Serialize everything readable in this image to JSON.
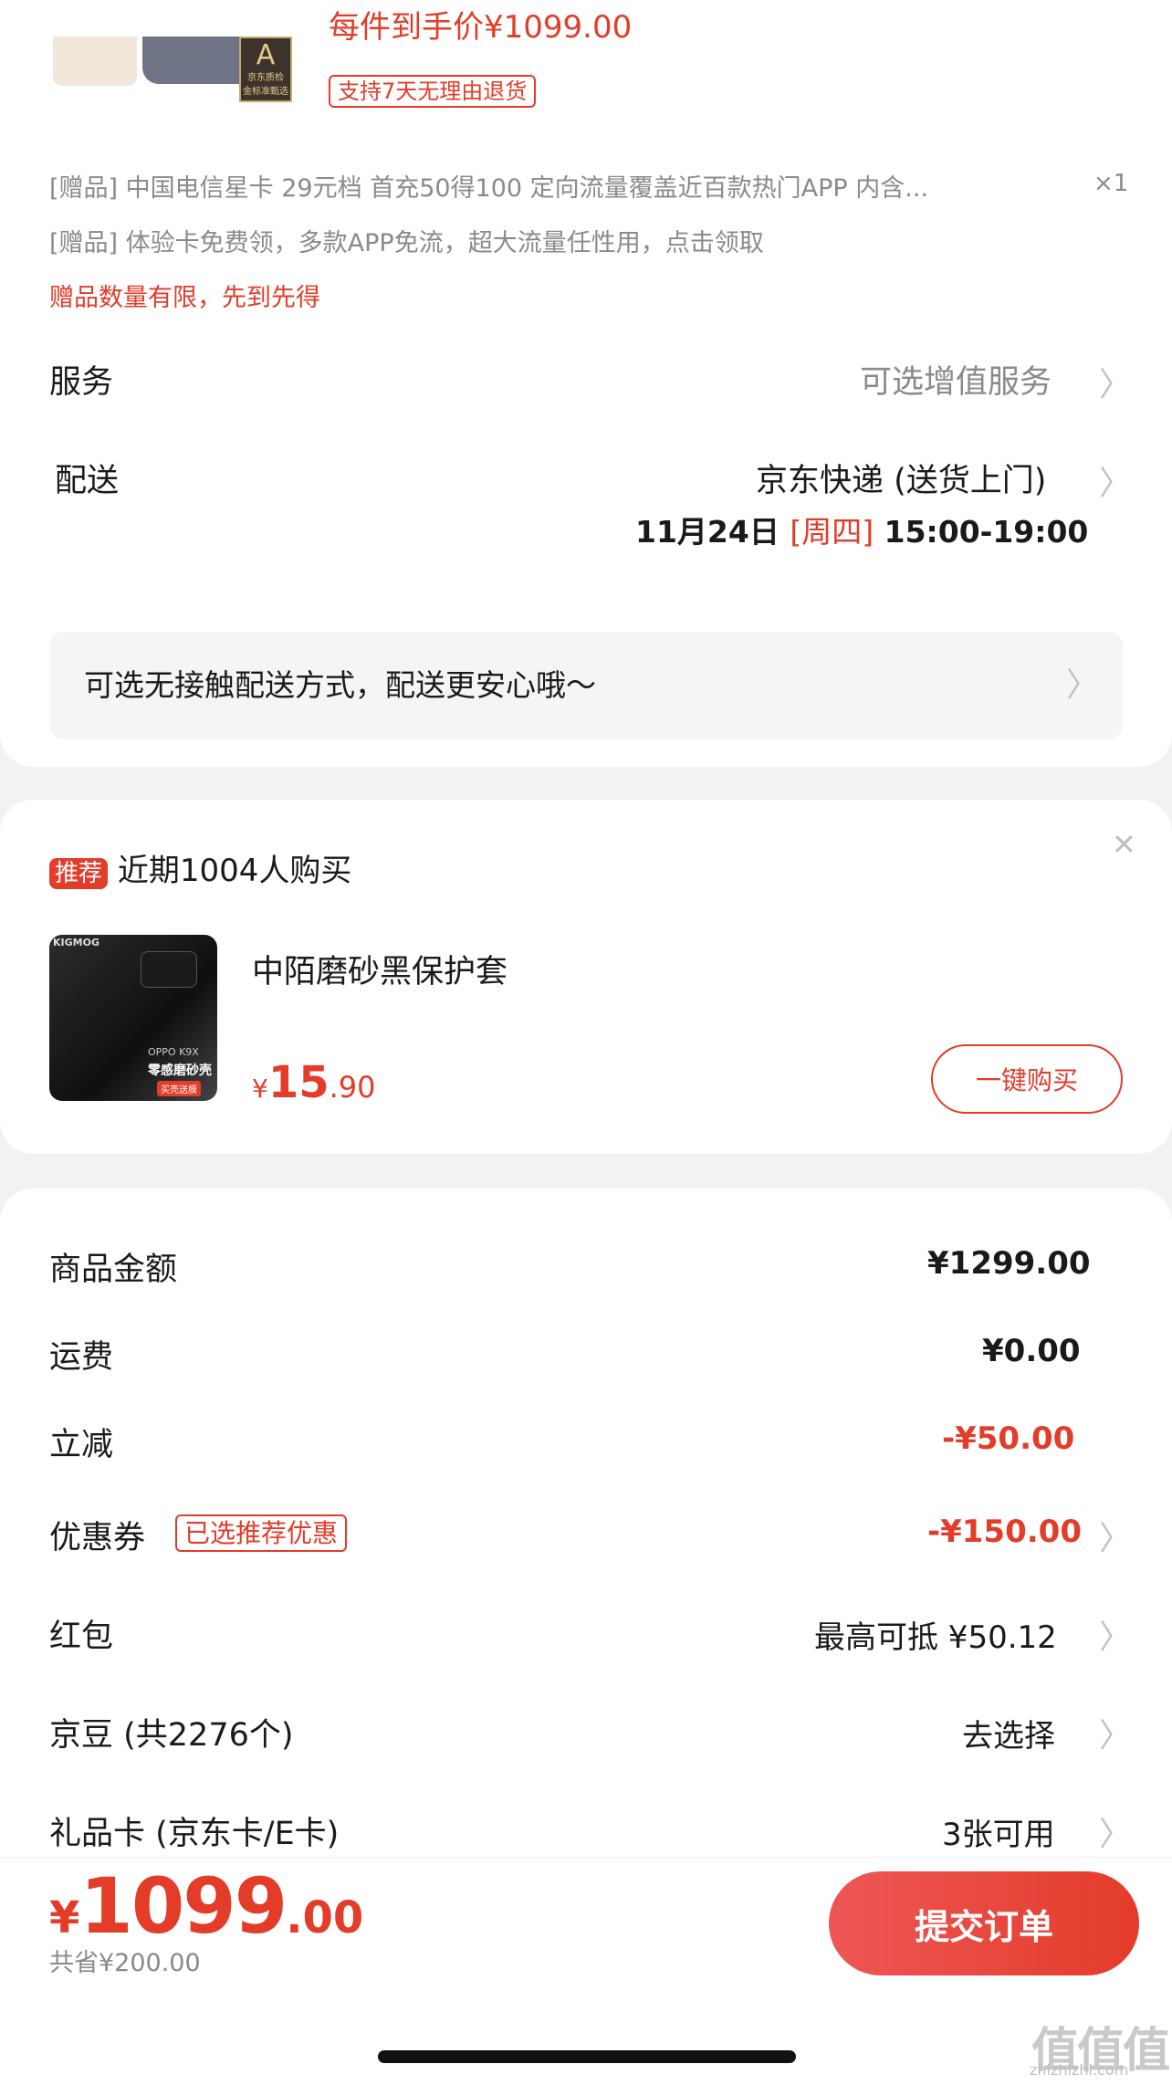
{
  "product": {
    "price_line": "每件到手价¥1099.00",
    "quality_badge_letter": "A",
    "quality_badge_text": "京东质检",
    "quality_badge_sub": "金标准甄选",
    "return_badge": "支持7天无理由退货"
  },
  "gifts": [
    {
      "label": "[赠品]",
      "text": "中国电信星卡 29元档 首充50得100 定向流量覆盖近百款热门APP 内含...",
      "qty": "×1"
    },
    {
      "label": "[赠品]",
      "text": "体验卡免费领，多款APP免流，超大流量任性用，点击领取",
      "qty": ""
    }
  ],
  "gift_notice": "赠品数量有限，先到先得",
  "service": {
    "label": "服务",
    "value": "可选增值服务"
  },
  "delivery": {
    "label": "配送",
    "method": "京东快递 (送货上门)",
    "date": "11月24日",
    "weekday": "[周四]",
    "time": "15:00-19:00"
  },
  "contactless_notice": "可选无接触配送方式，配送更安心哦～",
  "recommend": {
    "tag": "推荐",
    "headline": "近期1004人购买",
    "product_name": "中陌磨砂黑保护套",
    "currency": "¥",
    "price_int": "15",
    "price_dec": ".90",
    "image_brand": "KIGMOG",
    "image_model": "OPPO K9X",
    "image_caption": "零感磨砂壳",
    "image_promo": "买壳送膜",
    "buy_button": "一键购买"
  },
  "summary": {
    "rows": [
      {
        "label": "商品金额",
        "value": "¥1299.00",
        "tag": "",
        "chevron": false,
        "red": false
      },
      {
        "label": "运费",
        "value": "¥0.00",
        "tag": "",
        "chevron": false,
        "red": false
      },
      {
        "label": "立减",
        "value": "-¥50.00",
        "tag": "",
        "chevron": false,
        "red": true
      },
      {
        "label": "优惠券",
        "value": "-¥150.00",
        "tag": "已选推荐优惠",
        "chevron": true,
        "red": true
      },
      {
        "label": "红包",
        "value": "最高可抵 ¥50.12",
        "tag": "",
        "chevron": true,
        "red": false
      },
      {
        "label": "京豆 (共2276个)",
        "value": "去选择",
        "tag": "",
        "chevron": true,
        "red": false
      },
      {
        "label": "礼品卡 (京东卡/E卡)",
        "value": "3张可用",
        "tag": "",
        "chevron": true,
        "red": false
      }
    ]
  },
  "footer": {
    "currency": "¥",
    "total_int": "1099",
    "total_dec": ".00",
    "saved": "共省¥200.00",
    "submit": "提交订单"
  },
  "chevron_glyph": "〉",
  "close_glyph": "✕",
  "watermark": "值值值",
  "watermark_sub": "zhizhizhi.com",
  "colors": {
    "accent": "#e33c29",
    "muted": "#8a8a8a",
    "background": "#f2f2f2"
  }
}
